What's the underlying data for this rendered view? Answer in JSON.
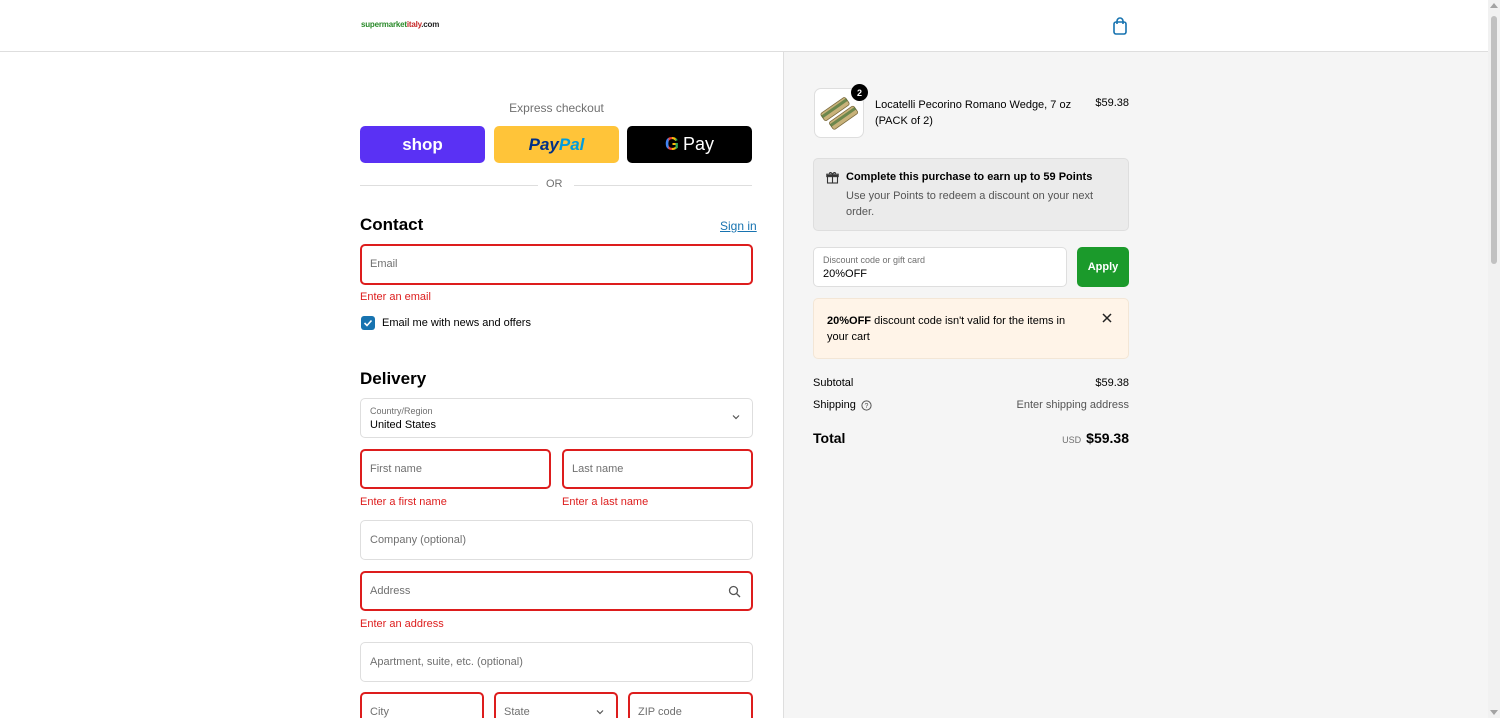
{
  "header": {
    "logo_green": "supermarket",
    "logo_red": "italy",
    "logo_tld": ".com"
  },
  "express": {
    "label": "Express checkout",
    "shop_label": "shop",
    "paypal_a": "Pay",
    "paypal_b": "Pal",
    "gpay_label": "Pay",
    "or": "OR"
  },
  "contact": {
    "heading": "Contact",
    "signin": "Sign in",
    "email_placeholder": "Email",
    "email_error": "Enter an email",
    "newsletter_label": "Email me with news and offers",
    "newsletter_checked": true
  },
  "delivery": {
    "heading": "Delivery",
    "country_label": "Country/Region",
    "country_value": "United States",
    "first_name_placeholder": "First name",
    "first_name_error": "Enter a first name",
    "last_name_placeholder": "Last name",
    "last_name_error": "Enter a last name",
    "company_placeholder": "Company (optional)",
    "address_placeholder": "Address",
    "address_error": "Enter an address",
    "apartment_placeholder": "Apartment, suite, etc. (optional)",
    "city_placeholder": "City",
    "state_placeholder": "State",
    "zip_placeholder": "ZIP code"
  },
  "summary": {
    "product": {
      "name": "Locatelli Pecorino Romano Wedge, 7 oz (PACK of 2)",
      "price": "$59.38",
      "quantity": "2"
    },
    "points": {
      "title": "Complete this purchase to earn up to 59 Points",
      "subtitle": "Use your Points to redeem a discount on your next order."
    },
    "discount": {
      "label": "Discount code or gift card",
      "value": "20%OFF",
      "apply": "Apply"
    },
    "warning": {
      "code": "20%OFF",
      "message": " discount code isn't valid for the items in your cart"
    },
    "subtotal_label": "Subtotal",
    "subtotal_value": "$59.38",
    "shipping_label": "Shipping",
    "shipping_value": "Enter shipping address",
    "total_label": "Total",
    "total_currency": "USD",
    "total_value": "$59.38"
  },
  "colors": {
    "error": "#dd1d1d",
    "link": "#1773b0",
    "shop": "#5a31f4",
    "paypal": "#ffc439",
    "apply": "#1b9a2b"
  }
}
